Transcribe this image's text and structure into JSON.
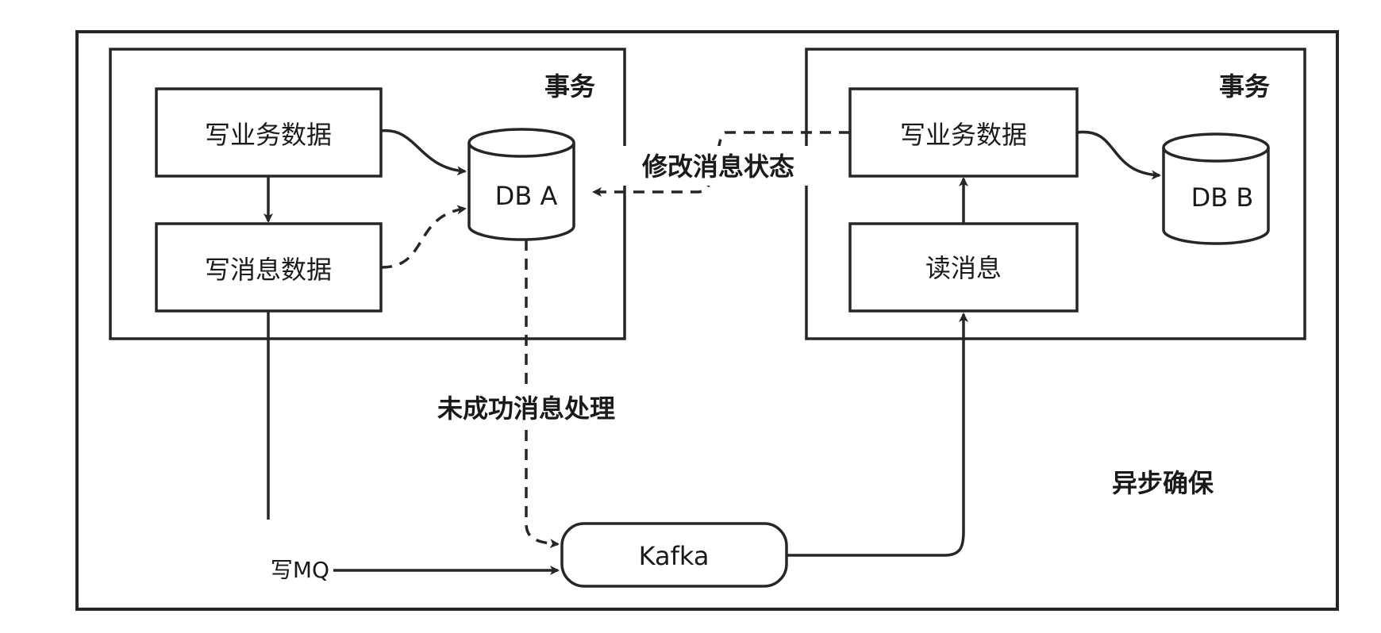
{
  "outer_label": "异步确保",
  "left_transaction": {
    "label": "事务",
    "write_business_box": "写业务数据",
    "write_message_box": "写消息数据",
    "database": "DB A"
  },
  "right_transaction": {
    "label": "事务",
    "write_business_box": "写业务数据",
    "read_message_box": "读消息",
    "database": "DB B"
  },
  "kafka": "Kafka",
  "edge_labels": {
    "modify_status": "修改消息状态",
    "failed_processing": "未成功消息处理",
    "write_mq": "写MQ"
  },
  "colors": {
    "stroke": "#262626",
    "background": "#ffffff"
  }
}
